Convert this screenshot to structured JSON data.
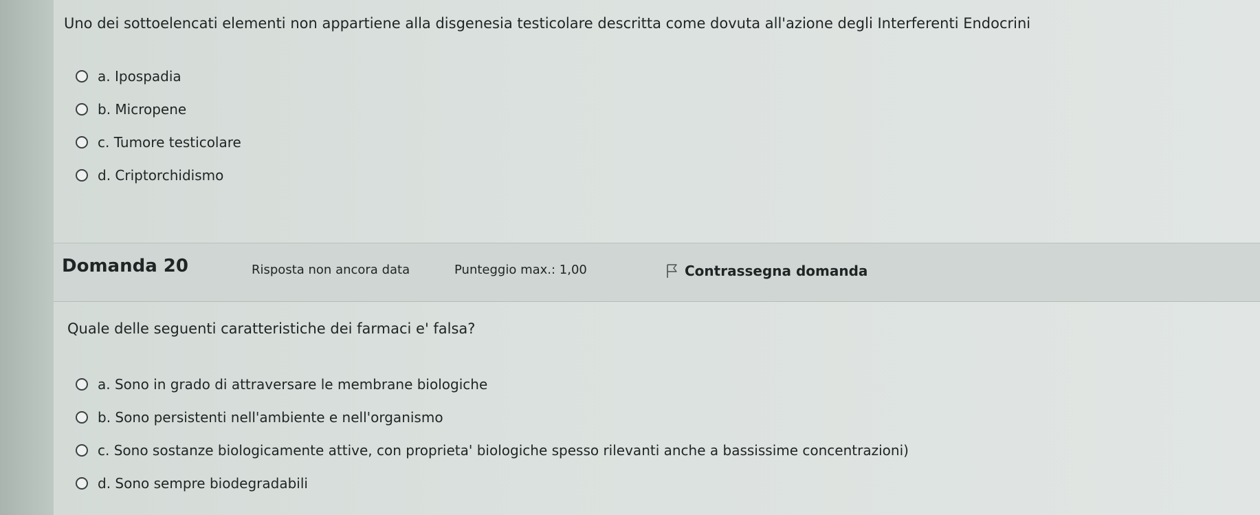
{
  "previous_question": {
    "text": "Uno dei sottoelencati elementi non appartiene alla disgenesia testicolare descritta come dovuta all'azione degli Interferenti Endocrini",
    "options": [
      {
        "label": "a. Ipospadia"
      },
      {
        "label": "b. Micropene"
      },
      {
        "label": "c. Tumore testicolare"
      },
      {
        "label": "d. Criptorchidismo"
      }
    ]
  },
  "question_info": {
    "number": "Domanda 20",
    "status": "Risposta non ancora data",
    "max_score": "Punteggio max.: 1,00",
    "flag_label": "Contrassegna domanda",
    "flag_icon": "flag-icon"
  },
  "current_question": {
    "text": "Quale delle seguenti caratteristiche dei farmaci e' falsa?",
    "options": [
      {
        "label": "a. Sono in grado di attraversare le membrane biologiche"
      },
      {
        "label": "b. Sono persistenti nell'ambiente e nell'organismo"
      },
      {
        "label": "c. Sono sostanze biologicamente attive, con proprieta' biologiche spesso rilevanti anche a bassissime concentrazioni)"
      },
      {
        "label": "d. Sono sempre biodegradabili"
      }
    ]
  }
}
